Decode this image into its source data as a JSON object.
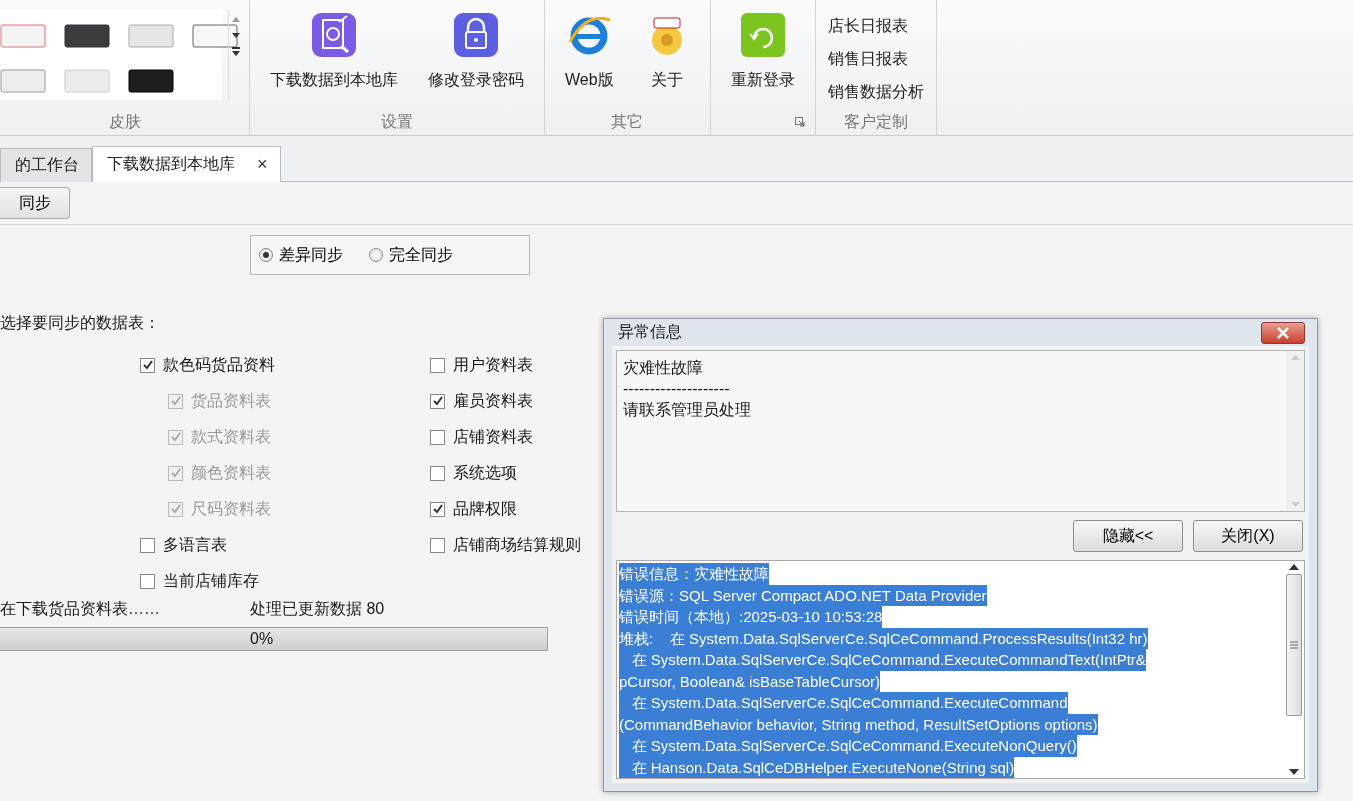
{
  "ribbon": {
    "groups": [
      {
        "kind": "gallery",
        "label": "皮肤"
      },
      {
        "kind": "buttons",
        "label": "设置",
        "buttons": [
          {
            "label": "下载数据到本地库"
          },
          {
            "label": "修改登录密码"
          }
        ]
      },
      {
        "kind": "buttons",
        "label": "其它",
        "buttons": [
          {
            "label": "Web版"
          },
          {
            "label": "关于"
          }
        ]
      },
      {
        "kind": "buttons",
        "buttons": [
          {
            "label": "重新登录"
          }
        ]
      },
      {
        "kind": "links",
        "label": "客户定制",
        "links": [
          "店长日报表",
          "销售日报表",
          "销售数据分析"
        ]
      }
    ]
  },
  "tabs": [
    {
      "label": "的工作台",
      "selected": false
    },
    {
      "label": "下载数据到本地库",
      "selected": true,
      "close": "×"
    }
  ],
  "toolbar": {
    "button": "同步"
  },
  "sync_modes": [
    {
      "label": "差异同步",
      "selected": true
    },
    {
      "label": "完全同步",
      "selected": false
    }
  ],
  "section_label": "选择要同步的数据表：",
  "table_columns": [
    {
      "items": [
        {
          "label": "款色码货品资料",
          "checked": true,
          "disabled": false,
          "children": [
            {
              "label": "货品资料表",
              "checked": true,
              "disabled": true
            },
            {
              "label": "款式资料表",
              "checked": true,
              "disabled": true
            },
            {
              "label": "颜色资料表",
              "checked": true,
              "disabled": true
            },
            {
              "label": "尺码资料表",
              "checked": true,
              "disabled": true
            }
          ]
        },
        {
          "label": "多语言表",
          "checked": false,
          "disabled": false
        },
        {
          "label": "当前店铺库存",
          "checked": false,
          "disabled": false
        }
      ]
    },
    {
      "items": [
        {
          "label": "用户资料表",
          "checked": false,
          "disabled": false
        },
        {
          "label": "雇员资料表",
          "checked": true,
          "disabled": false
        },
        {
          "label": "店铺资料表",
          "checked": false,
          "disabled": false
        },
        {
          "label": "系统选项",
          "checked": false,
          "disabled": false
        },
        {
          "label": "品牌权限",
          "checked": true,
          "disabled": false
        },
        {
          "label": "店铺商场结算规则",
          "checked": false,
          "disabled": false
        }
      ]
    }
  ],
  "status": {
    "message": "在下载货品资料表……",
    "count": "处理已更新数据 80"
  },
  "progress": {
    "level": 0,
    "text": "0%"
  },
  "dialog": {
    "title": "异常信息",
    "message": [
      "灾难性故障",
      "--------------------",
      "请联系管理员处理"
    ],
    "buttons": [
      "隐藏<<",
      "关闭(X)"
    ],
    "details": {
      "selected": true,
      "lines": [
        "错误信息：灾难性故障",
        "错误源：SQL Server Compact ADO.NET Data Provider",
        "错误时间（本地）:2025-03-10 10:53:28",
        "堆栈:    在 System.Data.SqlServerCe.SqlCeCommand.ProcessResults(Int32 hr)",
        "   在 System.Data.SqlServerCe.SqlCeCommand.ExecuteCommandText(IntPtr&",
        "pCursor, Boolean& isBaseTableCursor)",
        "   在 System.Data.SqlServerCe.SqlCeCommand.ExecuteCommand",
        "(CommandBehavior behavior, String method, ResultSetOptions options)",
        "   在 System.Data.SqlServerCe.SqlCeCommand.ExecuteNonQuery()",
        "   在 Hanson.Data.SqlCeDBHelper.ExecuteNone(String sql)"
      ]
    }
  }
}
